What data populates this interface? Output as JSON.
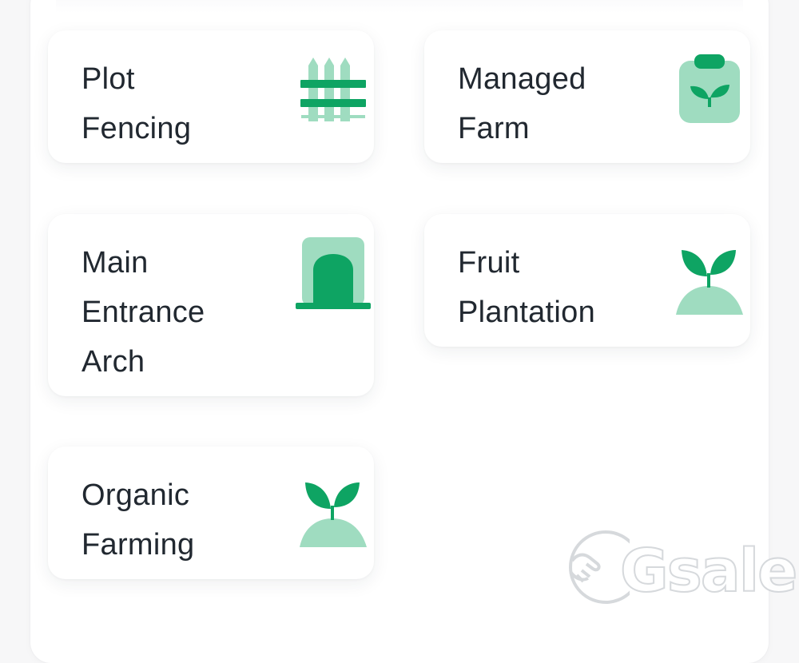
{
  "cards": [
    {
      "title": "Plot\nFencing",
      "icon": "fence-icon"
    },
    {
      "title": "Managed\nFarm",
      "icon": "clipboard-sprout-icon"
    },
    {
      "title": "Main\nEntrance\nArch",
      "icon": "arch-icon"
    },
    {
      "title": "Fruit\nPlantation",
      "icon": "sprout-mound-icon"
    },
    {
      "title": "Organic\nFarming",
      "icon": "sprout-mound-icon"
    }
  ],
  "watermark": {
    "text": "Gsale"
  },
  "colors": {
    "accent_dark": "#0ea463",
    "accent_light": "#9fdcc0",
    "text": "#212830",
    "card_bg": "#ffffff"
  }
}
